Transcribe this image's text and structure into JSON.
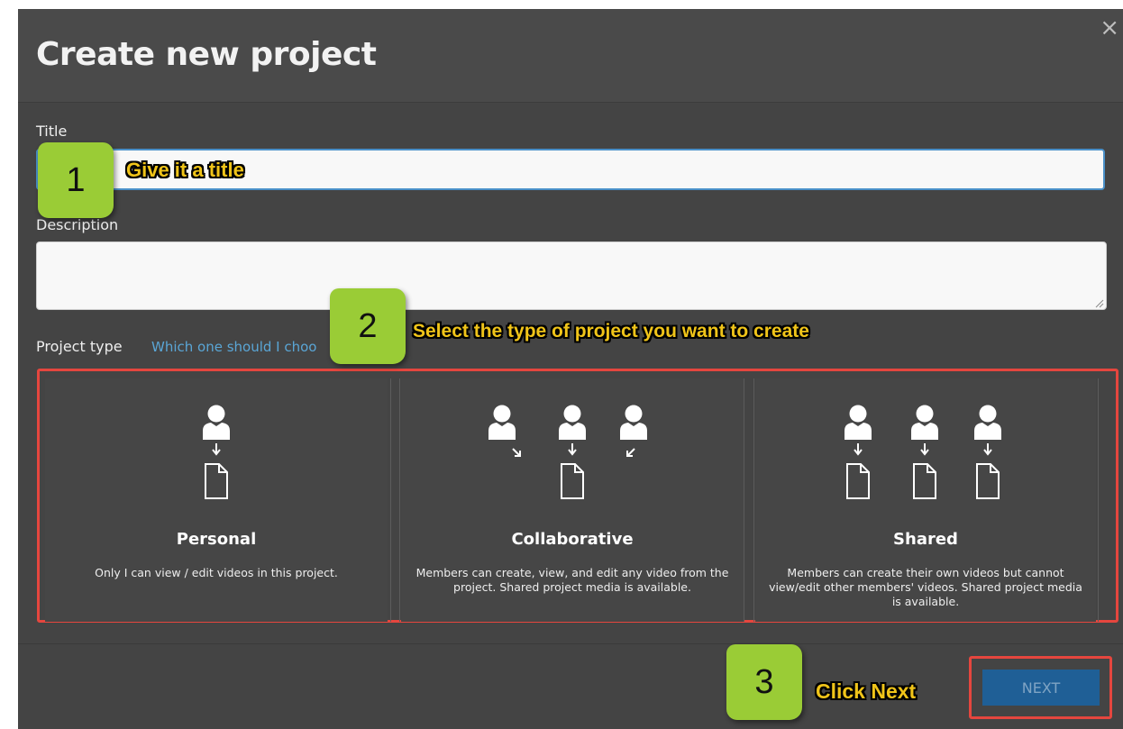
{
  "dialog": {
    "title": "Create new project",
    "close_label": "×"
  },
  "form": {
    "title_label": "Title",
    "title_value": "",
    "description_label": "Description",
    "description_value": "",
    "project_type_label": "Project type",
    "help_link": "Which one should I choo"
  },
  "project_types": [
    {
      "name": "Personal",
      "description": "Only I can view / edit videos in this project."
    },
    {
      "name": "Collaborative",
      "description": "Members can create, view, and edit any video from the project. Shared project media is available."
    },
    {
      "name": "Shared",
      "description": "Members can create their own videos but cannot view/edit other members' videos. Shared project media is available."
    }
  ],
  "footer": {
    "next_label": "NEXT"
  },
  "annotations": {
    "step1": {
      "number": "1",
      "text": "Give it a title"
    },
    "step2": {
      "number": "2",
      "text": "Select the type of project you want to create"
    },
    "step3": {
      "number": "3",
      "text": "Click Next"
    }
  },
  "colors": {
    "dialog_bg": "#444444",
    "input_focus_border": "#4a90c8",
    "link": "#5aa6d6",
    "highlight_frame": "#e5463e",
    "next_button": "#1f5f96",
    "badge": "#9acc36",
    "callout_text": "#f0c419"
  },
  "icons": [
    "close-icon",
    "person-icon",
    "arrow-icon",
    "document-icon",
    "resize-grip-icon"
  ]
}
